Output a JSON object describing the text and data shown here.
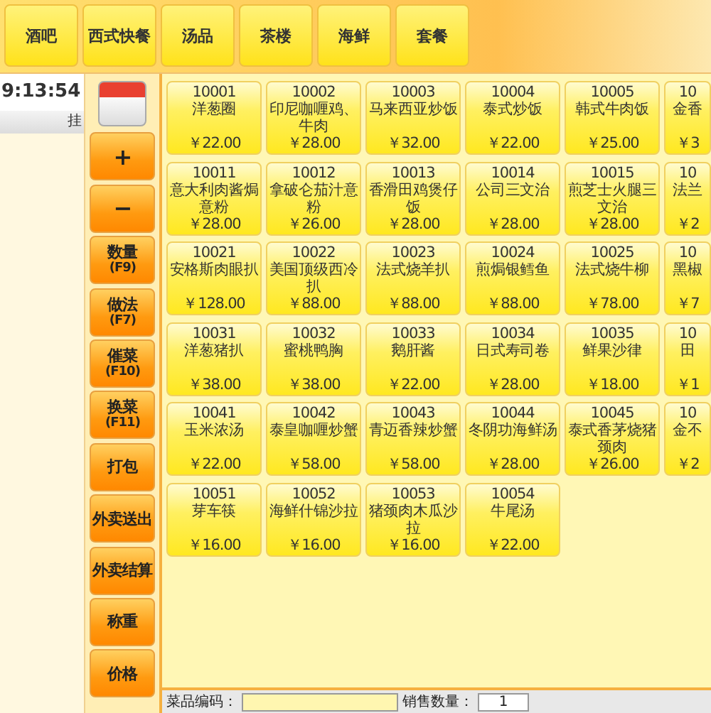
{
  "categories": [
    {
      "label": "酒吧",
      "selected": false
    },
    {
      "label": "西式快餐",
      "selected": false
    },
    {
      "label": "汤品",
      "selected": false
    },
    {
      "label": "茶楼",
      "selected": false
    },
    {
      "label": "海鲜",
      "selected": false
    },
    {
      "label": "套餐",
      "selected": false
    }
  ],
  "left_panel": {
    "time": "9:13:54",
    "tab": "挂"
  },
  "actions": [
    {
      "label": "+"
    },
    {
      "label": "−"
    },
    {
      "label": "数量",
      "shortcut": "(F9)"
    },
    {
      "label": "做法",
      "shortcut": "(F7)"
    },
    {
      "label": "催菜",
      "shortcut": "(F10)"
    },
    {
      "label": "换菜",
      "shortcut": "(F11)"
    },
    {
      "label": "打包"
    },
    {
      "label": "外卖送出"
    },
    {
      "label": "外卖结算"
    },
    {
      "label": "称重"
    },
    {
      "label": "价格"
    }
  ],
  "dishes": [
    {
      "code": "10001",
      "name": "洋葱圈",
      "price": "￥22.00"
    },
    {
      "code": "10002",
      "name": "印尼咖喱鸡、牛肉",
      "price": "￥28.00"
    },
    {
      "code": "10003",
      "name": "马来西亚炒饭",
      "price": "￥32.00"
    },
    {
      "code": "10004",
      "name": "泰式炒饭",
      "price": "￥22.00"
    },
    {
      "code": "10005",
      "name": "韩式牛肉饭",
      "price": "￥25.00"
    },
    {
      "code": "10",
      "name": "金香",
      "price": "￥3"
    },
    {
      "code": "10011",
      "name": "意大利肉酱焗意粉",
      "price": "￥28.00"
    },
    {
      "code": "10012",
      "name": "拿破仑茄汁意粉",
      "price": "￥26.00"
    },
    {
      "code": "10013",
      "name": "香滑田鸡煲仔饭",
      "price": "￥28.00"
    },
    {
      "code": "10014",
      "name": "公司三文治",
      "price": "￥28.00"
    },
    {
      "code": "10015",
      "name": "煎芝士火腿三文治",
      "price": "￥28.00"
    },
    {
      "code": "10",
      "name": "法兰",
      "price": "￥2"
    },
    {
      "code": "10021",
      "name": "安格斯肉眼扒",
      "price": "￥128.00"
    },
    {
      "code": "10022",
      "name": "美国顶级西冷扒",
      "price": "￥88.00"
    },
    {
      "code": "10023",
      "name": "法式烧羊扒",
      "price": "￥88.00"
    },
    {
      "code": "10024",
      "name": "煎焗银鳕鱼",
      "price": "￥88.00"
    },
    {
      "code": "10025",
      "name": "法式烧牛柳",
      "price": "￥78.00"
    },
    {
      "code": "10",
      "name": "黑椒",
      "price": "￥7"
    },
    {
      "code": "10031",
      "name": "洋葱猪扒",
      "price": "￥38.00"
    },
    {
      "code": "10032",
      "name": "蜜桃鸭胸",
      "price": "￥38.00"
    },
    {
      "code": "10033",
      "name": "鹅肝酱",
      "price": "￥22.00"
    },
    {
      "code": "10034",
      "name": "日式寿司卷",
      "price": "￥28.00"
    },
    {
      "code": "10035",
      "name": "鲜果沙律",
      "price": "￥18.00"
    },
    {
      "code": "10",
      "name": "田",
      "price": "￥1"
    },
    {
      "code": "10041",
      "name": "玉米浓汤",
      "price": "￥22.00"
    },
    {
      "code": "10042",
      "name": "泰皇咖喱炒蟹",
      "price": "￥58.00"
    },
    {
      "code": "10043",
      "name": "青迈香辣炒蟹",
      "price": "￥58.00"
    },
    {
      "code": "10044",
      "name": "冬阴功海鲜汤",
      "price": "￥28.00"
    },
    {
      "code": "10045",
      "name": "泰式香茅烧猪颈肉",
      "price": "￥26.00"
    },
    {
      "code": "10",
      "name": "金不",
      "price": "￥2"
    },
    {
      "code": "10051",
      "name": "芽车筷",
      "price": "￥16.00"
    },
    {
      "code": "10052",
      "name": "海鲜什锦沙拉",
      "price": "￥16.00"
    },
    {
      "code": "10053",
      "name": "猪颈肉木瓜沙拉",
      "price": "￥16.00"
    },
    {
      "code": "10054",
      "name": "牛尾汤",
      "price": "￥22.00"
    }
  ],
  "bottom_bar": {
    "code_label": "菜品编码：",
    "quantity_label": "销售数量：",
    "quantity": "1"
  }
}
